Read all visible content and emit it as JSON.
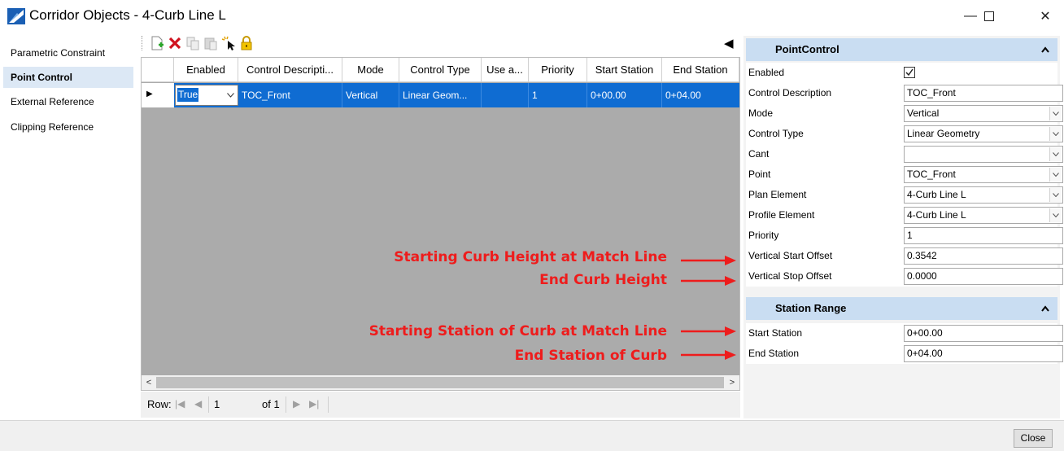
{
  "window": {
    "title": "Corridor Objects - 4-Curb Line L",
    "minimize": "—",
    "maximize": "☐",
    "close": "✕"
  },
  "nav": {
    "items": [
      {
        "label": "Parametric Constraint",
        "active": false
      },
      {
        "label": "Point Control",
        "active": true
      },
      {
        "label": "External Reference",
        "active": false
      },
      {
        "label": "Clipping Reference",
        "active": false
      }
    ]
  },
  "toolbar": {
    "icons": [
      "new-row-icon",
      "delete-icon",
      "copy-icon",
      "paste-icon",
      "select-icon",
      "lock-icon"
    ],
    "collapse_arrow": "◀"
  },
  "grid": {
    "columns": [
      "Enabled",
      "Control Descripti...",
      "Mode",
      "Control Type",
      "Use a...",
      "Priority",
      "Start Station",
      "End Station"
    ],
    "row": {
      "indicator": "▶",
      "enabled": "True",
      "control_description": "TOC_Front",
      "mode": "Vertical",
      "control_type": "Linear Geom...",
      "use_a": "",
      "priority": "1",
      "start_station": "0+00.00",
      "end_station": "0+04.00"
    }
  },
  "pager": {
    "row_label": "Row:",
    "current": "1",
    "of_label": "of 1"
  },
  "annotations": {
    "start_height": "Starting Curb Height at Match Line",
    "end_height": "End Curb Height",
    "start_station": "Starting Station of Curb at Match Line",
    "end_station": "End Station of Curb",
    "color": "#ee1c1c"
  },
  "panel": {
    "section1_title": "PointControl",
    "props": [
      {
        "label": "Enabled",
        "value": "",
        "type": "check"
      },
      {
        "label": "Control Description",
        "value": "TOC_Front",
        "type": "text"
      },
      {
        "label": "Mode",
        "value": "Vertical",
        "type": "dd"
      },
      {
        "label": "Control Type",
        "value": "Linear Geometry",
        "type": "dd"
      },
      {
        "label": "Cant",
        "value": "",
        "type": "dd"
      },
      {
        "label": "Point",
        "value": "TOC_Front",
        "type": "dd"
      },
      {
        "label": "Plan Element",
        "value": "4-Curb Line L",
        "type": "dd"
      },
      {
        "label": "Profile Element",
        "value": "4-Curb Line L",
        "type": "dd"
      },
      {
        "label": "Priority",
        "value": "1",
        "type": "text"
      },
      {
        "label": "Vertical Start Offset",
        "value": "0.3542",
        "type": "text"
      },
      {
        "label": "Vertical Stop Offset",
        "value": "0.0000",
        "type": "text"
      }
    ],
    "section2_title": "Station Range",
    "station_props": [
      {
        "label": "Start Station",
        "value": "0+00.00"
      },
      {
        "label": "End Station",
        "value": "0+04.00"
      }
    ]
  },
  "footer": {
    "close_label": "Close"
  }
}
